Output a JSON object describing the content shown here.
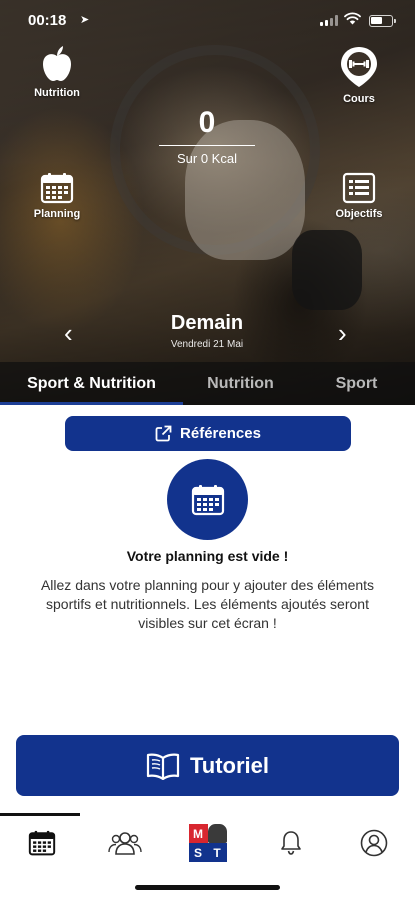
{
  "status_bar": {
    "time": "00:18"
  },
  "hero": {
    "shortcuts": {
      "nutrition_label": "Nutrition",
      "cours_label": "Cours",
      "planning_label": "Planning",
      "objectifs_label": "Objectifs"
    },
    "kcal": {
      "value": "0",
      "subtitle": "Sur 0 Kcal"
    },
    "day": {
      "title": "Demain",
      "date": "Vendredi 21 Mai"
    }
  },
  "tabs": [
    {
      "label": "Sport & Nutrition",
      "active": true
    },
    {
      "label": "Nutrition",
      "active": false
    },
    {
      "label": "Sport",
      "active": false
    }
  ],
  "content": {
    "references_label": "Références",
    "empty_title": "Votre planning est vide !",
    "empty_text": "Allez dans votre planning pour y ajouter des éléments sportifs et nutritionnels. Les éléments ajoutés seront visibles sur cet écran !",
    "tutorial_label": "Tutoriel"
  },
  "bottom_nav": {
    "items": [
      {
        "icon": "calendar-icon",
        "active": true
      },
      {
        "icon": "community-icon",
        "active": false
      },
      {
        "icon": "mst-logo",
        "active": false
      },
      {
        "icon": "bell-icon",
        "active": false
      },
      {
        "icon": "profile-icon",
        "active": false
      }
    ],
    "logo_letters": [
      "M",
      "S",
      "T"
    ]
  },
  "colors": {
    "brand_blue": "#12338d",
    "logo_red": "#d8262f",
    "logo_blue": "#12338d",
    "logo_gray": "#3a3a3a"
  }
}
